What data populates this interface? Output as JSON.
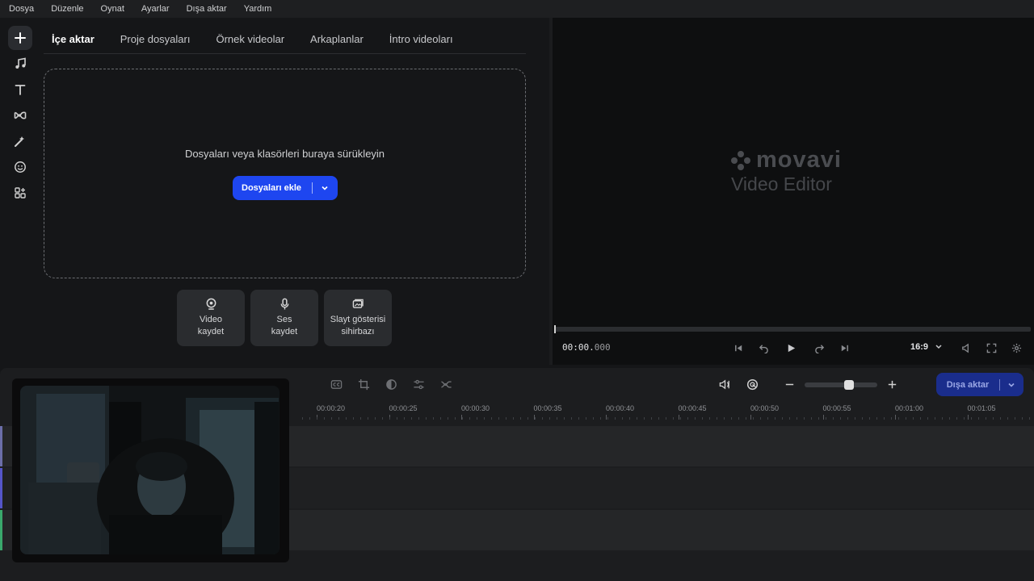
{
  "menu": [
    "Dosya",
    "Düzenle",
    "Oynat",
    "Ayarlar",
    "Dışa aktar",
    "Yardım"
  ],
  "left_tools": [
    {
      "name": "add-icon",
      "active": true
    },
    {
      "name": "music-icon",
      "active": false
    },
    {
      "name": "text-icon",
      "active": false
    },
    {
      "name": "transition-icon",
      "active": false
    },
    {
      "name": "magic-wand-icon",
      "active": false
    },
    {
      "name": "sticker-icon",
      "active": false
    },
    {
      "name": "more-tools-icon",
      "active": false
    }
  ],
  "import": {
    "tabs": [
      "İçe aktar",
      "Proje dosyaları",
      "Örnek videolar",
      "Arkaplanlar",
      "İntro videoları"
    ],
    "active_tab": 0,
    "drop_text": "Dosyaları veya klasörleri buraya sürükleyin",
    "add_button": "Dosyaları ekle",
    "record_buttons": [
      {
        "line1": "Video",
        "line2": "kaydet",
        "icon": "webcam-icon"
      },
      {
        "line1": "Ses",
        "line2": "kaydet",
        "icon": "microphone-icon"
      },
      {
        "line1": "Slayt gösterisi",
        "line2": "sihirbazı",
        "icon": "slideshow-icon"
      }
    ]
  },
  "preview": {
    "brand": "movavi",
    "product": "Video Editor",
    "time_main": "00:00.",
    "time_ms": "000",
    "aspect_ratio": "16:9",
    "progress": 0
  },
  "timeline": {
    "export_button": "Dışa aktar",
    "zoom_level": 0.58,
    "ruler_labels": [
      "00:00:20",
      "00:00:25",
      "00:00:30",
      "00:00:35",
      "00:00:40",
      "00:00:45",
      "00:00:50",
      "00:00:55",
      "00:01:00",
      "00:01:05"
    ]
  },
  "colors": {
    "accent": "#1e46f0",
    "export_disabled": "#1a2d8c",
    "track_video": "#6c6ea8",
    "track_audio": "#5555c8",
    "track_music": "#3aa86c"
  }
}
